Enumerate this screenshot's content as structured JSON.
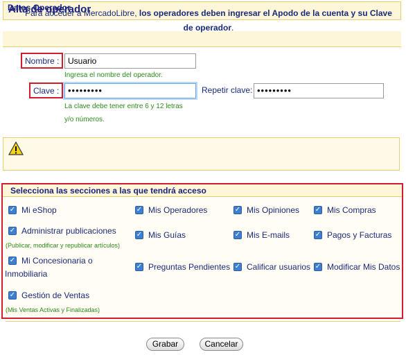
{
  "header": {
    "title": "Alta de operador"
  },
  "datos": {
    "section_title": "Datos Operador",
    "nombre_label": "Nombre :",
    "nombre_value": "Usuario",
    "nombre_hint": "Ingresa el nombre del operador.",
    "clave_label": "Clave :",
    "clave_value": "•••••••••",
    "clave_hint_1": "La clave debe tener entre 6 y 12 letras",
    "clave_hint_2": "y/o números.",
    "repetir_label": "Repetir clave:",
    "repetir_value": "•••••••••"
  },
  "warning": {
    "icon": "warning-icon",
    "text_plain_1": "Para acceder a MercadoLibre, ",
    "text_bold": "los operadores deben ingresar el Apodo de la cuenta y su Clave de operador",
    "text_plain_2": "."
  },
  "permissions": {
    "title": "Selecciona las secciones a las que tendrá acceso",
    "items": [
      {
        "label": "Mi eShop",
        "checked": true
      },
      {
        "label": "Mis Operadores",
        "checked": true
      },
      {
        "label": "Mis Opiniones",
        "checked": true
      },
      {
        "label": "Mis Compras",
        "checked": true
      },
      {
        "label": "Administrar publicaciones",
        "checked": true,
        "sub": "(Publicar, modificar y republicar artículos)"
      },
      {
        "label": "Mis Guías",
        "checked": true
      },
      {
        "label": "Mis E-mails",
        "checked": true
      },
      {
        "label": "Pagos y Facturas",
        "checked": true
      },
      {
        "label_1": "Mi Concesionaria o",
        "label_2": "Inmobiliaria",
        "checked": true
      },
      {
        "label": "Preguntas Pendientes",
        "checked": true
      },
      {
        "label": "Calificar usuarios",
        "checked": true
      },
      {
        "label": "Modificar Mis Datos",
        "checked": true
      },
      {
        "label": "Gestión de Ventas",
        "checked": true,
        "sub": "(Mis Ventas Activas y Finalizadas)"
      }
    ]
  },
  "actions": {
    "save_label": "Grabar",
    "cancel_label": "Cancelar"
  },
  "colors": {
    "accent_red": "#d41b2c",
    "header_bg": "#fdf6d8",
    "hint_green": "#2d8a1c",
    "text_blue": "#1a2a7a",
    "check_blue": "#3f7fd0"
  }
}
